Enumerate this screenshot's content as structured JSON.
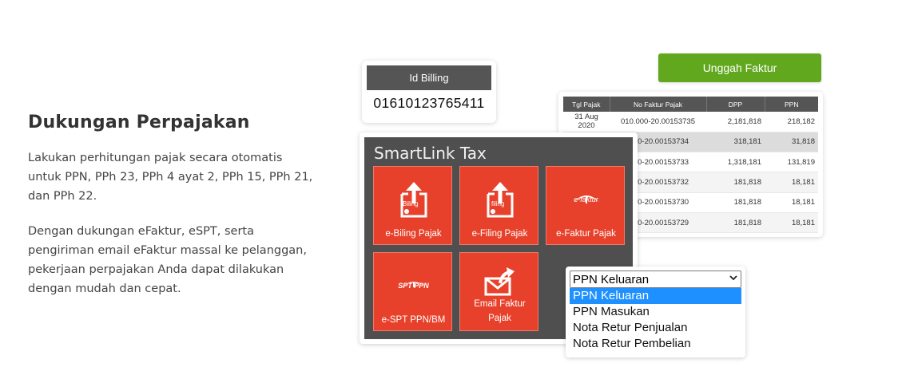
{
  "section": {
    "title": "Dukungan Perpajakan",
    "paragraph1": "Lakukan perhitungan pajak secara otomatis untuk PPN, PPh 23, PPh 4 ayat 2, PPh 15, PPh 21, dan PPh 22.",
    "paragraph2": "Dengan dukungan eFaktur, eSPT, serta pengiriman email eFaktur massal ke pelanggan, pekerjaan perpajakan Anda dapat dilakukan dengan mudah dan cepat."
  },
  "billing": {
    "header": "Id Billing",
    "number": "01610123765411"
  },
  "upload_button": "Unggah Faktur",
  "faktur_table": {
    "headers": [
      "Tgl Pajak",
      "No Faktur Pajak",
      "DPP",
      "PPN"
    ],
    "rows": [
      [
        "31 Aug 2020",
        "010.000-20.00153735",
        "2,181,818",
        "218,182"
      ],
      [
        "",
        ".000-20.00153734",
        "318,181",
        "31,818"
      ],
      [
        "",
        ".000-20.00153733",
        "1,318,181",
        "131,819"
      ],
      [
        "",
        ".000-20.00153732",
        "181,818",
        "18,181"
      ],
      [
        "",
        ".000-20.00153730",
        "181,818",
        "18,181"
      ],
      [
        "",
        ".000-20.00153729",
        "181,818",
        "18,181"
      ]
    ]
  },
  "smartlink": {
    "title": "SmartLink Tax",
    "tiles": [
      {
        "label": "e-Biling Pajak",
        "icon_text": "Biling",
        "icon": "upload-billing-icon"
      },
      {
        "label": "e-Filing Pajak",
        "icon_text": "filing",
        "icon": "upload-filing-icon"
      },
      {
        "label": "e-Faktur Pajak",
        "icon_text": "e-faktur",
        "icon": "efaktur-logo-icon"
      },
      {
        "label": "e-SPT PPN/BM",
        "icon_text": "SPT PPN",
        "icon": "spt-ppn-logo-icon"
      },
      {
        "label_line1": "Email Faktur",
        "label_line2": "Pajak",
        "icon": "email-send-icon"
      }
    ]
  },
  "dropdown": {
    "selected": "PPN Keluaran",
    "options": [
      "PPN Keluaran",
      "PPN Masukan",
      "Nota Retur Penjualan",
      "Nota Retur Pembelian"
    ]
  },
  "colors": {
    "accent_green": "#62a81e",
    "tile_red": "#e8412b",
    "panel_dark": "#4f4f4f",
    "select_blue": "#1e90ff"
  }
}
